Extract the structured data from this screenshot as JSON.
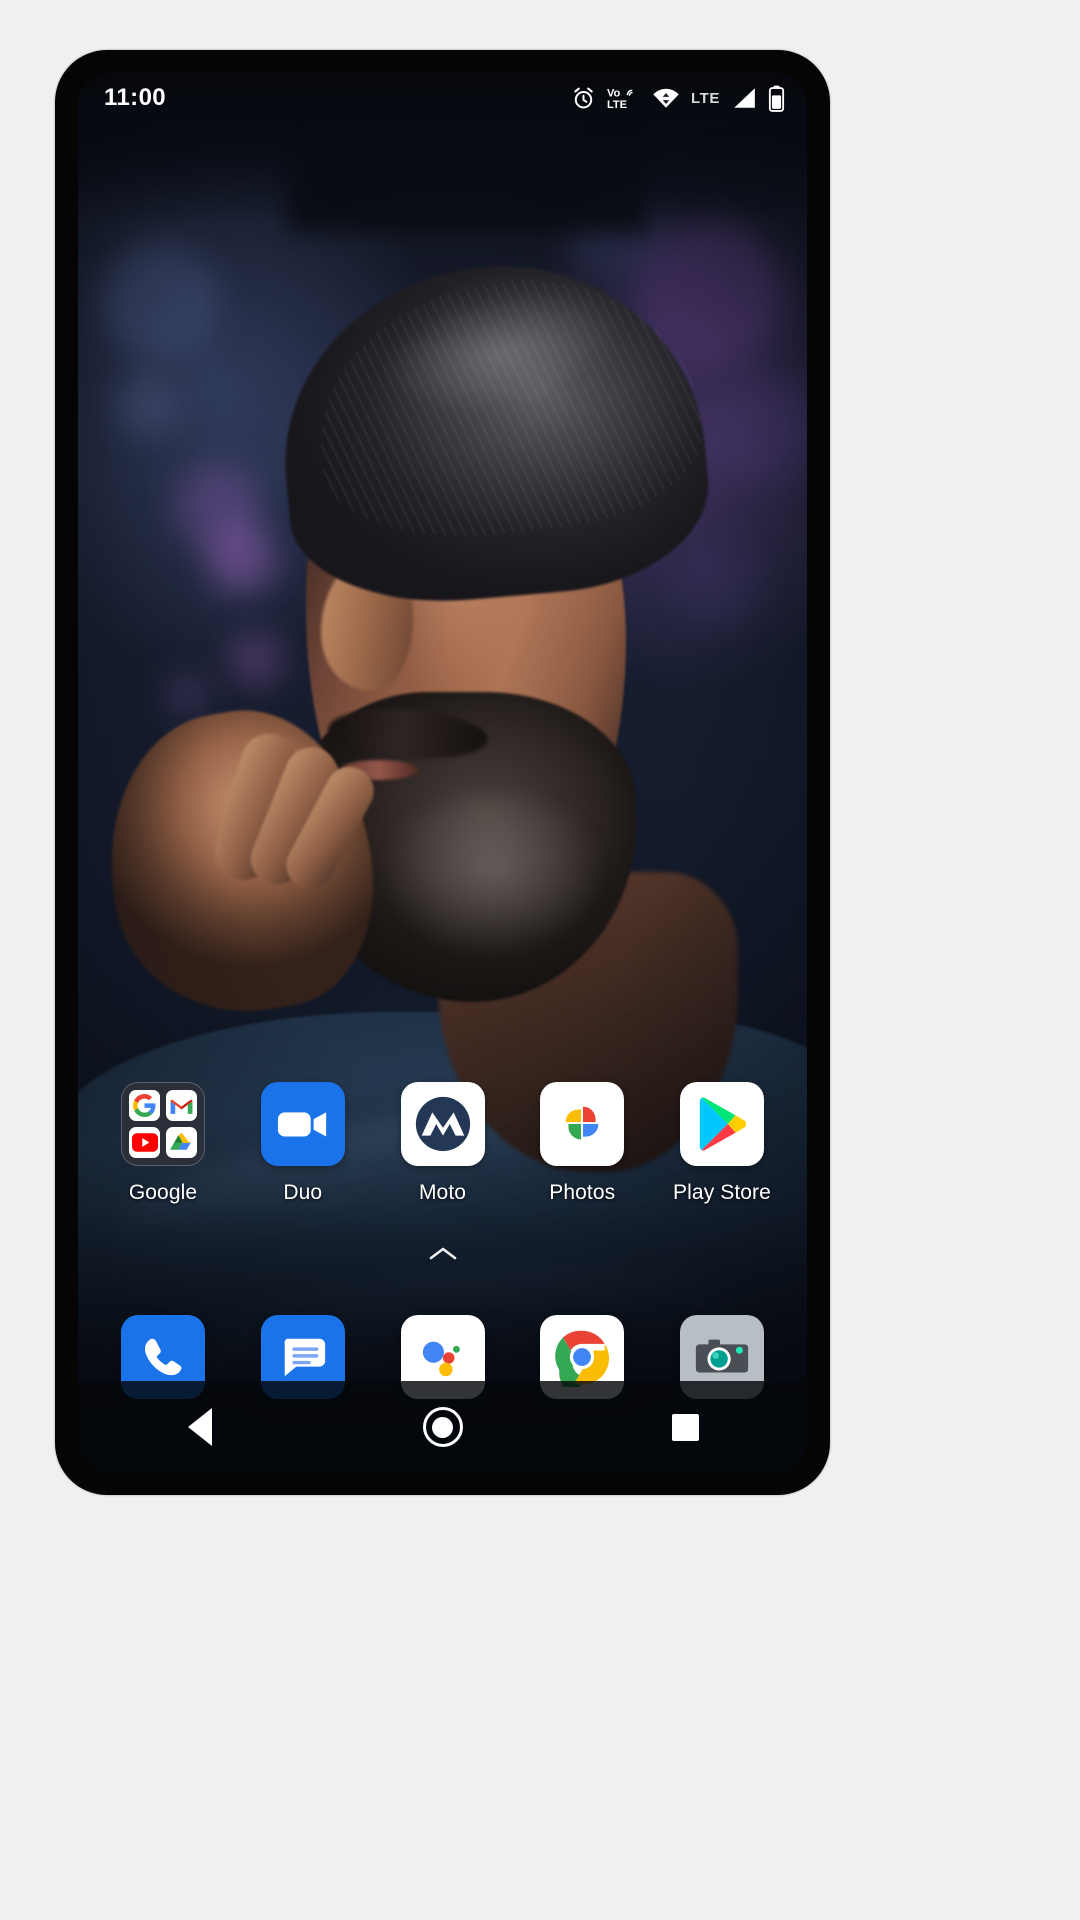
{
  "status_bar": {
    "time": "11:00",
    "icons": [
      {
        "name": "alarm-icon",
        "label": "Alarm set"
      },
      {
        "name": "volte-icon",
        "label": "VoLTE"
      },
      {
        "name": "wifi-icon",
        "label": "Wi-Fi connected"
      },
      {
        "name": "lte-label",
        "label": "LTE"
      },
      {
        "name": "cellular-signal-icon",
        "label": "Signal full"
      },
      {
        "name": "battery-icon",
        "label": "Battery"
      }
    ],
    "lte_text": "LTE"
  },
  "home_screen": {
    "apps": [
      {
        "label": "Google",
        "icon": "google-folder-icon",
        "type": "folder",
        "contents": [
          "Google",
          "Gmail",
          "YouTube",
          "Drive"
        ]
      },
      {
        "label": "Duo",
        "icon": "duo-icon",
        "type": "app"
      },
      {
        "label": "Moto",
        "icon": "moto-icon",
        "type": "app"
      },
      {
        "label": "Photos",
        "icon": "photos-icon",
        "type": "app"
      },
      {
        "label": "Play Store",
        "icon": "play-store-icon",
        "type": "app"
      }
    ],
    "app_drawer_handle": "chevron-up-icon"
  },
  "dock": {
    "items": [
      {
        "label": "Phone",
        "icon": "phone-icon"
      },
      {
        "label": "Messages",
        "icon": "messages-icon"
      },
      {
        "label": "Assistant",
        "icon": "google-assistant-icon"
      },
      {
        "label": "Chrome",
        "icon": "chrome-icon"
      },
      {
        "label": "Camera",
        "icon": "camera-icon"
      }
    ]
  },
  "nav_bar": {
    "back": "Back",
    "home": "Home",
    "recents": "Recents"
  },
  "colors": {
    "google_blue": "#4285F4",
    "google_red": "#EA4335",
    "google_yellow": "#FBBC04",
    "google_green": "#34A853",
    "dock_blue": "#1A73E8",
    "moto_navy": "#243757",
    "camera_grey": "#B8BFC4",
    "camera_teal": "#009E8E"
  }
}
